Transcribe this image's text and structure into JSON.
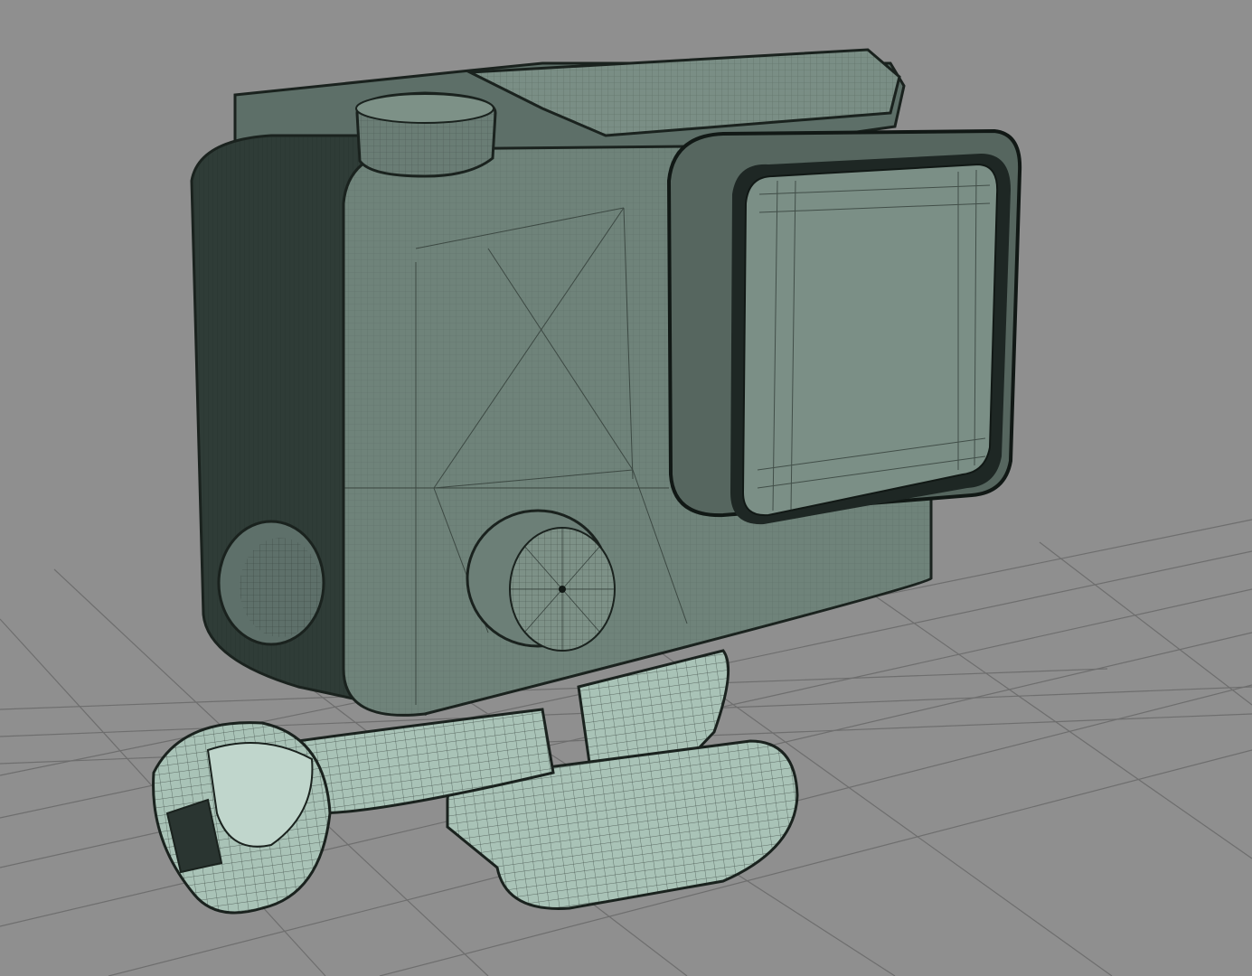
{
  "viewport": {
    "background": "#8f8f8f",
    "grid_color": "#6e6e6e",
    "object": "action-camera-housing-wireframe",
    "shade_colors": {
      "light": "#7d9187",
      "mid": "#5f716a",
      "dark": "#2e3a36",
      "wire": "#1c2420",
      "mount": "#a9c3b7"
    }
  }
}
